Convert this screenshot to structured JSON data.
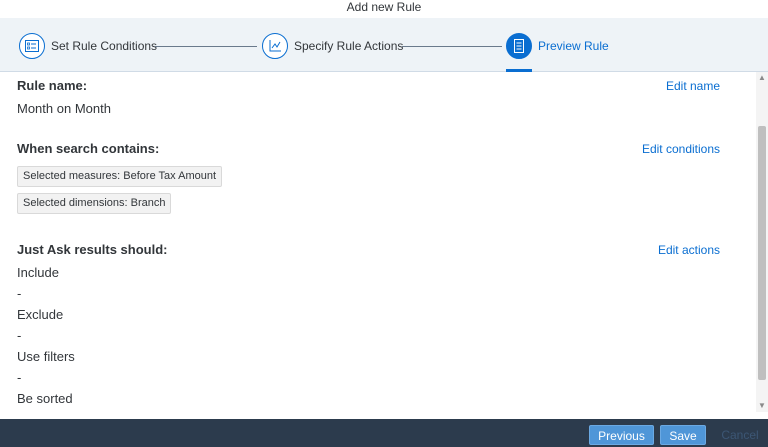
{
  "dialog": {
    "title": "Add new Rule"
  },
  "wizard": {
    "steps": [
      {
        "label": "Set Rule Conditions",
        "icon": "list-checkbox-icon"
      },
      {
        "label": "Specify Rule Actions",
        "icon": "chart-axis-icon"
      },
      {
        "label": "Preview Rule",
        "icon": "document-icon"
      }
    ],
    "active_step": "Preview Rule"
  },
  "rule": {
    "name_heading": "Rule name:",
    "name_value": "Month on Month",
    "edit_name": "Edit name",
    "conditions_heading": "When search contains:",
    "edit_conditions": "Edit conditions",
    "tokens": [
      "Selected measures: Before Tax Amount",
      "Selected dimensions: Branch"
    ],
    "results_heading": "Just Ask results should:",
    "edit_actions": "Edit actions",
    "include_label": "Include",
    "include_value": "-",
    "exclude_label": "Exclude",
    "exclude_value": "-",
    "filters_label": "Use filters",
    "filters_value": "-",
    "sorted_label": "Be sorted"
  },
  "footer": {
    "previous_label": "Previous",
    "save_label": "Save",
    "cancel_label": "Cancel"
  },
  "colors": {
    "accent": "#0a6ed1",
    "footer_bg": "#2c3b4d",
    "wizard_bg": "#eef3f7",
    "button_bg": "#4f96d8"
  }
}
